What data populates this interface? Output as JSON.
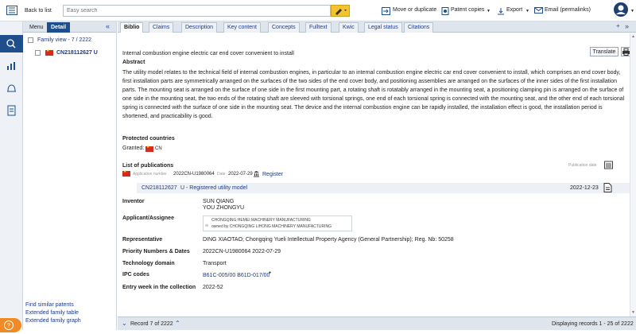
{
  "topbar": {
    "back_label": "Back to list",
    "search_placeholder": "Easy search",
    "move_label": "Move or duplicate",
    "patent_copies_label": "Patent copies",
    "export_label": "Export",
    "email_label": "Email (permalinks)"
  },
  "left": {
    "tabs": [
      "Menu",
      "Detail"
    ],
    "family_view": "Family view - 7 / 2222",
    "family_item": "CN218112627 U",
    "links": [
      "Find similar patents",
      "Extended family table",
      "Extended family graph"
    ]
  },
  "tabs": [
    "Biblio",
    "Claims",
    "Description",
    "Key content",
    "Concepts",
    "Fulltext",
    "Kwic",
    "Legal status",
    "Citations"
  ],
  "biblio": {
    "translate": "Translate",
    "title": "Internal combustion engine electric car end cover convenient to install",
    "abstract_heading": "Abstract",
    "abstract": "The utility model relates to the technical field of internal combustion engines, in particular to an internal combustion engine electric car end cover convenient to install, which comprises an end cover body, first installation parts are symmetrically arranged on the surfaces of the two sides of the end cover body, and positioning assemblies are arranged on the surfaces of the inner sides of the first installation parts. The mounting seat is arranged on the surface of one side in the first mounting part, a rotating shaft is rotatably arranged in the mounting seat, a positioning clamping pin is arranged on the surface of one side in the mounting seat, the two ends of the rotating shaft are sleeved with torsional springs, one end of each torsional spring is connected with the mounting seat, and the other end of each torsional spring is connected with the surface of one side in the mounting seat. The device and the internal combustion engine can be rapidly installed, the installation effect is good, the installation period is shortened, and practicability is good.",
    "protected_heading": "Protected countries",
    "granted_label": "Granted:",
    "granted_country": "CN",
    "publications_heading": "List of publications",
    "publication_date_label": "Publication date",
    "app_number_label": "Application number",
    "app_number": "2022CN-U1980064",
    "date_label": "Date",
    "app_date": "2022-07-29",
    "register_label": "Register",
    "pub_number": "CN218112627",
    "pub_kind": "U - Registered utility model",
    "pub_date": "2022-12-23",
    "inventor_label": "Inventor",
    "inventors": [
      "SUN QIANG",
      "YOU ZHONGYU"
    ],
    "applicant_label": "Applicant/Assignee",
    "applicant_name": "CHONGQING HEMEI MACHINERY MANUFACTURING",
    "applicant_owner": "owned by CHONGQING LIHONG MACHINERY MANUFACTURING",
    "representative_label": "Representative",
    "representative": "DING XIAOTAO; Chongqing Yueli Intellectual Property Agency (General Partnership); Reg. Nb: 50258",
    "priority_label": "Priority Numbers & Dates",
    "priority": "2022CN-U1980064 2022-07-29",
    "techdomain_label": "Technology domain",
    "techdomain": "Transport",
    "ipc_label": "IPC codes",
    "ipc": "B61C-005/00 B61D-017/00",
    "entry_label": "Entry week in the collection",
    "entry": "2022-52"
  },
  "footer": {
    "record": "Record 7 of 2222",
    "displaying": "Displaying records 1 - 25 of 2222"
  },
  "colors": {
    "brand": "#1f4e8c",
    "search_button": "#f5c32c",
    "help": "#f08a24"
  }
}
